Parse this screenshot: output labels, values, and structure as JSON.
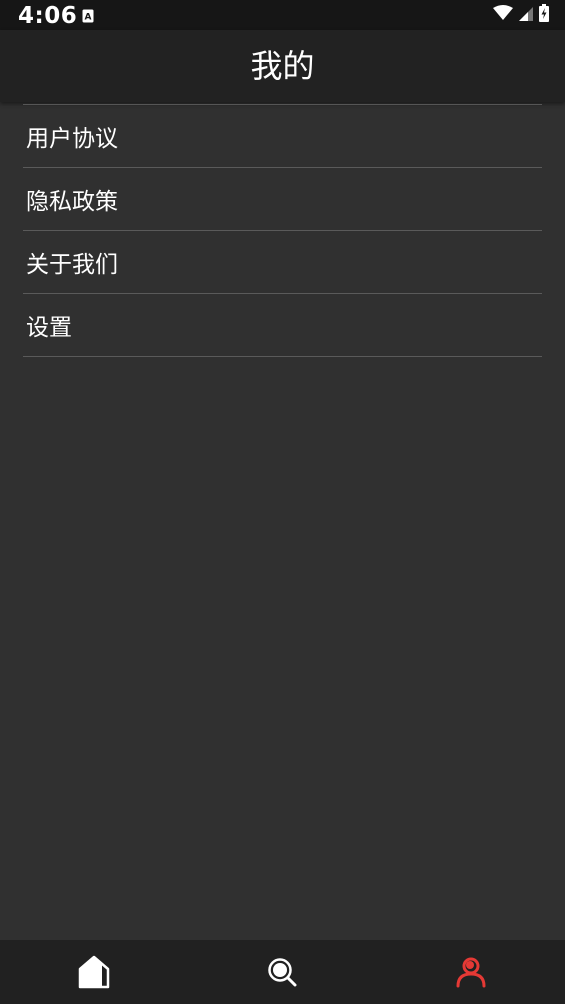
{
  "status_bar": {
    "time": "4:06",
    "icons": [
      "notification-a-icon",
      "wifi-icon",
      "signal-icon",
      "battery-charging-icon"
    ]
  },
  "header": {
    "title": "我的"
  },
  "menu": {
    "items": [
      {
        "label": "用户协议"
      },
      {
        "label": "隐私政策"
      },
      {
        "label": "关于我们"
      },
      {
        "label": "设置"
      }
    ]
  },
  "bottom_nav": {
    "items": [
      {
        "icon": "home-icon",
        "active": false
      },
      {
        "icon": "search-icon",
        "active": false
      },
      {
        "icon": "user-icon",
        "active": true
      }
    ],
    "active_color": "#e53935",
    "inactive_color": "#ffffff"
  },
  "colors": {
    "background": "#303030",
    "app_bar": "#222222",
    "status_bar": "#161616",
    "nav_bar": "#212121"
  }
}
